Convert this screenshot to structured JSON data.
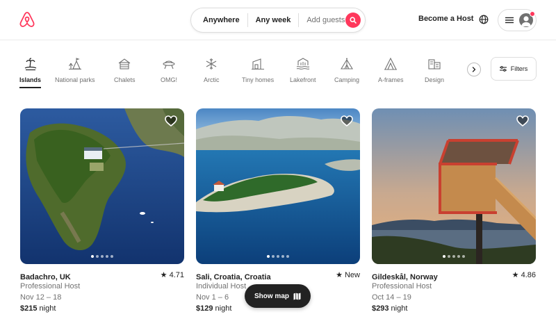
{
  "header": {
    "logo_icon": "airbnb-logo",
    "search": {
      "where": "Anywhere",
      "when": "Any week",
      "guests_placeholder": "Add guests",
      "search_icon": "search-icon"
    },
    "become_host": "Become a Host",
    "globe_icon": "globe-icon",
    "menu_icon": "hamburger-icon",
    "avatar_icon": "user-avatar-icon"
  },
  "categories": [
    {
      "label": "Islands",
      "icon": "island-icon",
      "active": true
    },
    {
      "label": "National parks",
      "icon": "national-park-icon",
      "active": false
    },
    {
      "label": "Chalets",
      "icon": "chalet-icon",
      "active": false
    },
    {
      "label": "OMG!",
      "icon": "ufo-house-icon",
      "active": false
    },
    {
      "label": "Arctic",
      "icon": "snowflake-icon",
      "active": false
    },
    {
      "label": "Tiny homes",
      "icon": "tiny-home-icon",
      "active": false
    },
    {
      "label": "Lakefront",
      "icon": "lakefront-icon",
      "active": false
    },
    {
      "label": "Camping",
      "icon": "camping-icon",
      "active": false
    },
    {
      "label": "A-frames",
      "icon": "a-frame-icon",
      "active": false
    },
    {
      "label": "Design",
      "icon": "design-icon",
      "active": false
    }
  ],
  "filters_label": "Filters",
  "listings": [
    {
      "location": "Badachro, UK",
      "rating": "★ 4.71",
      "host": "Professional Host",
      "dates": "Nov 12 – 18",
      "price": "$215",
      "price_unit": " night"
    },
    {
      "location": "Sali, Croatia, Croatia",
      "rating": "★ New",
      "host": "Individual Host",
      "dates": "Nov 1 – 6",
      "price": "$129",
      "price_unit": " night"
    },
    {
      "location": "Gildeskål, Norway",
      "rating": "★ 4.86",
      "host": "Professional Host",
      "dates": "Oct 14 – 19",
      "price": "$293",
      "price_unit": " night"
    }
  ],
  "show_map": "Show map",
  "colors": {
    "brand": "#ff385c",
    "text": "#222222",
    "muted": "#717171",
    "border": "#dddddd"
  }
}
